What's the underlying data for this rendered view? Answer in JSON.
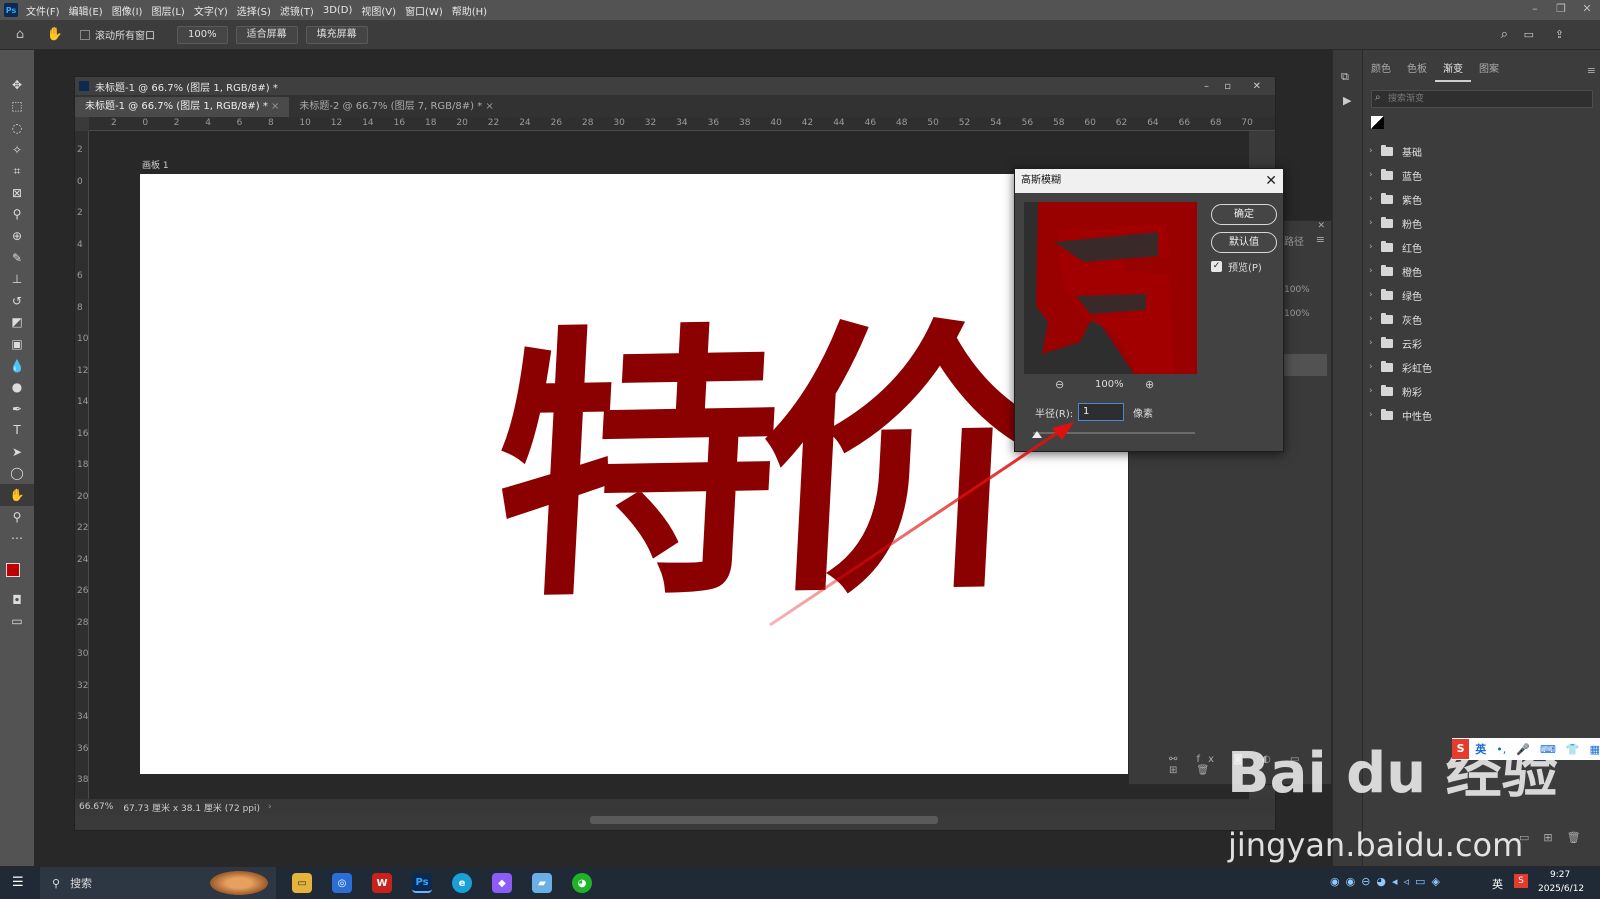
{
  "menubar": {
    "items": [
      "文件(F)",
      "编辑(E)",
      "图像(I)",
      "图层(L)",
      "文字(Y)",
      "选择(S)",
      "滤镜(T)",
      "3D(D)",
      "视图(V)",
      "窗口(W)",
      "帮助(H)"
    ]
  },
  "options": {
    "scroll_all": "滚动所有窗口",
    "zoom": "100%",
    "fit_screen": "适合屏幕",
    "fill_screen": "填充屏幕"
  },
  "document": {
    "title": "未标题-1 @ 66.7% (图层 1, RGB/8#) *",
    "tabs": [
      "未标题-1 @ 66.7% (图层 1, RGB/8#) *",
      "未标题-2 @ 66.7% (图层 7, RGB/8#) *"
    ],
    "artboard_name": "画板 1",
    "canvas_text": "特价",
    "hruler": [
      "2",
      "0",
      "2",
      "4",
      "6",
      "8",
      "10",
      "12",
      "14",
      "16",
      "18",
      "20",
      "22",
      "24",
      "26",
      "28",
      "30",
      "32",
      "34",
      "36",
      "38",
      "40",
      "42",
      "44",
      "46",
      "48",
      "50",
      "52",
      "54",
      "56",
      "58",
      "60",
      "62",
      "64",
      "66",
      "68",
      "70"
    ],
    "vruler": [
      "2",
      "0",
      "2",
      "4",
      "6",
      "8",
      "10",
      "12",
      "14",
      "16",
      "18",
      "20",
      "22",
      "24",
      "26",
      "28",
      "30",
      "32",
      "34",
      "36",
      "38"
    ],
    "status_zoom": "66.67%",
    "status_size": "67.73 厘米 x 38.1 厘米 (72 ppi)"
  },
  "dialog": {
    "title": "高斯模糊",
    "ok": "确定",
    "default": "默认值",
    "preview_label": "预览(P)",
    "preview_checked": true,
    "zoom": "100%",
    "radius_label": "半径(R):",
    "radius_value": "1",
    "unit": "像素"
  },
  "bg_panel": {
    "tab": "路径",
    "opacity1": "100%",
    "opacity2": "100%"
  },
  "right_panel": {
    "tabs": [
      "颜色",
      "色板",
      "渐变",
      "图案"
    ],
    "active_tab": "渐变",
    "search_placeholder": "搜索渐变",
    "folders": [
      "基础",
      "蓝色",
      "紫色",
      "粉色",
      "红色",
      "橙色",
      "绿色",
      "灰色",
      "云彩",
      "彩虹色",
      "粉彩",
      "中性色"
    ]
  },
  "taskbar": {
    "search": "搜索",
    "time": "9:27",
    "date": "2025/6/12",
    "lang": "英"
  },
  "watermark": {
    "line1": "Bai du 经验",
    "line2": "jingyan.baidu.com"
  },
  "ime": {
    "lang": "英"
  },
  "colors": {
    "text_red": "#8b0000",
    "foreground": "#c00000",
    "arrow": "#e01010"
  }
}
